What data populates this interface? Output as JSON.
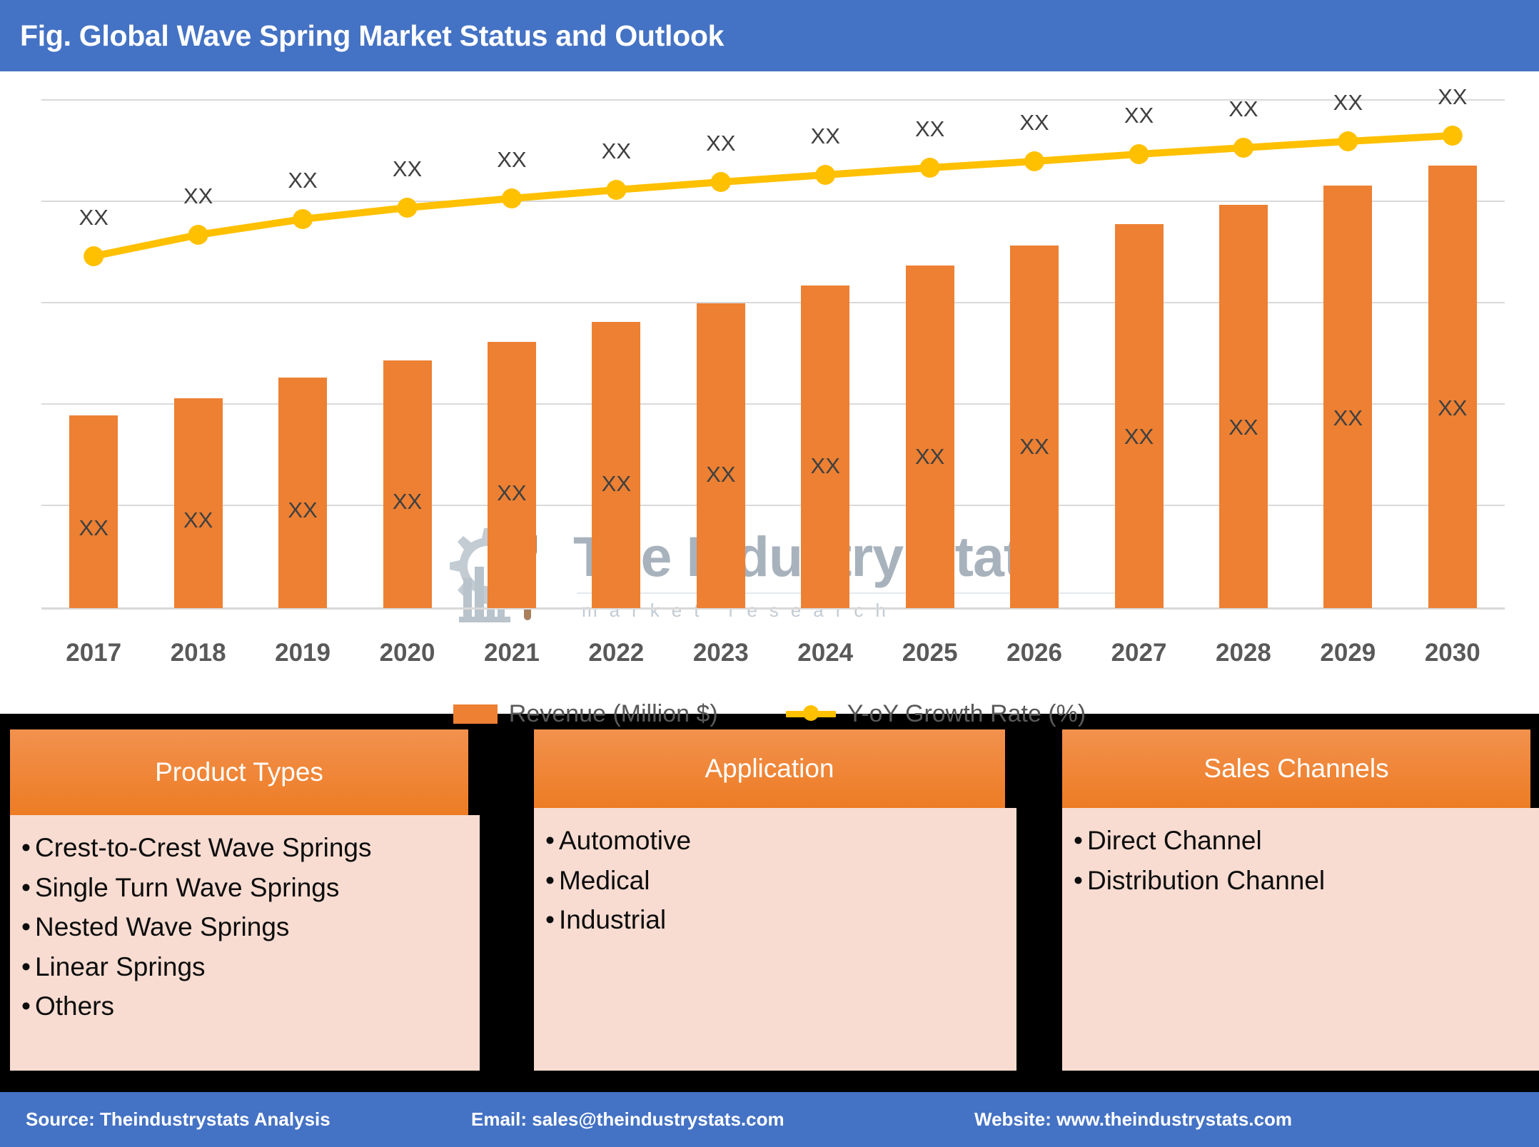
{
  "header": {
    "title": "Fig. Global Wave Spring Market Status and Outlook"
  },
  "watermark": {
    "brand": "The Industry Stats",
    "tagline": "market research",
    "logo_icon": "gear-wrench-factory-icon",
    "color": "#A7B2BC"
  },
  "chart_data": {
    "type": "bar",
    "title": "Fig. Global Wave Spring Market Status and Outlook",
    "xlabel": "",
    "ylabel": "",
    "grid": true,
    "legend_position": "bottom",
    "categories": [
      "2017",
      "2018",
      "2019",
      "2020",
      "2021",
      "2022",
      "2023",
      "2024",
      "2025",
      "2026",
      "2027",
      "2028",
      "2029",
      "2030"
    ],
    "series": [
      {
        "name": "Revenue (Million $)",
        "type": "bar",
        "color": "#ED8032",
        "values": [
          270,
          294,
          323,
          347,
          373,
          401,
          427,
          452,
          480,
          508,
          538,
          565,
          592,
          620
        ],
        "data_labels": [
          "XX",
          "XX",
          "XX",
          "XX",
          "XX",
          "XX",
          "XX",
          "XX",
          "XX",
          "XX",
          "XX",
          "XX",
          "XX",
          "XX"
        ]
      },
      {
        "name": "Y-oY Growth Rate (%)",
        "type": "line",
        "color": "#FFC000",
        "marker": "circle",
        "values": [
          493,
          523,
          545,
          561,
          574,
          586,
          597,
          607,
          617,
          626,
          636,
          645,
          654,
          662
        ],
        "data_labels": [
          "XX",
          "XX",
          "XX",
          "XX",
          "XX",
          "XX",
          "XX",
          "XX",
          "XX",
          "XX",
          "XX",
          "XX",
          "XX",
          "XX"
        ]
      }
    ],
    "ylim": [
      0,
      712
    ],
    "gridline_values": [
      712,
      570,
      428,
      286,
      144,
      0
    ]
  },
  "legend": {
    "items": [
      {
        "label": "Revenue (Million $)",
        "swatch": "bar",
        "color": "#ED8032"
      },
      {
        "label": "Y-oY Growth Rate (%)",
        "swatch": "line-marker",
        "color": "#FFC000"
      }
    ]
  },
  "cards": [
    {
      "id": "product",
      "title": "Product Types",
      "items": [
        "Crest-to-Crest Wave Springs",
        "Single Turn Wave Springs",
        "Nested Wave Springs",
        "Linear Springs",
        "Others"
      ]
    },
    {
      "id": "application",
      "title": "Application",
      "items": [
        "Automotive",
        "Medical",
        "Industrial"
      ]
    },
    {
      "id": "sales",
      "title": "Sales Channels",
      "items": [
        "Direct Channel",
        "Distribution Channel"
      ]
    }
  ],
  "footer": {
    "source": "Source: Theindustrystats Analysis",
    "email": "Email: sales@theindustrystats.com",
    "website": "Website: www.theindustrystats.com"
  },
  "bullet_char": "•"
}
